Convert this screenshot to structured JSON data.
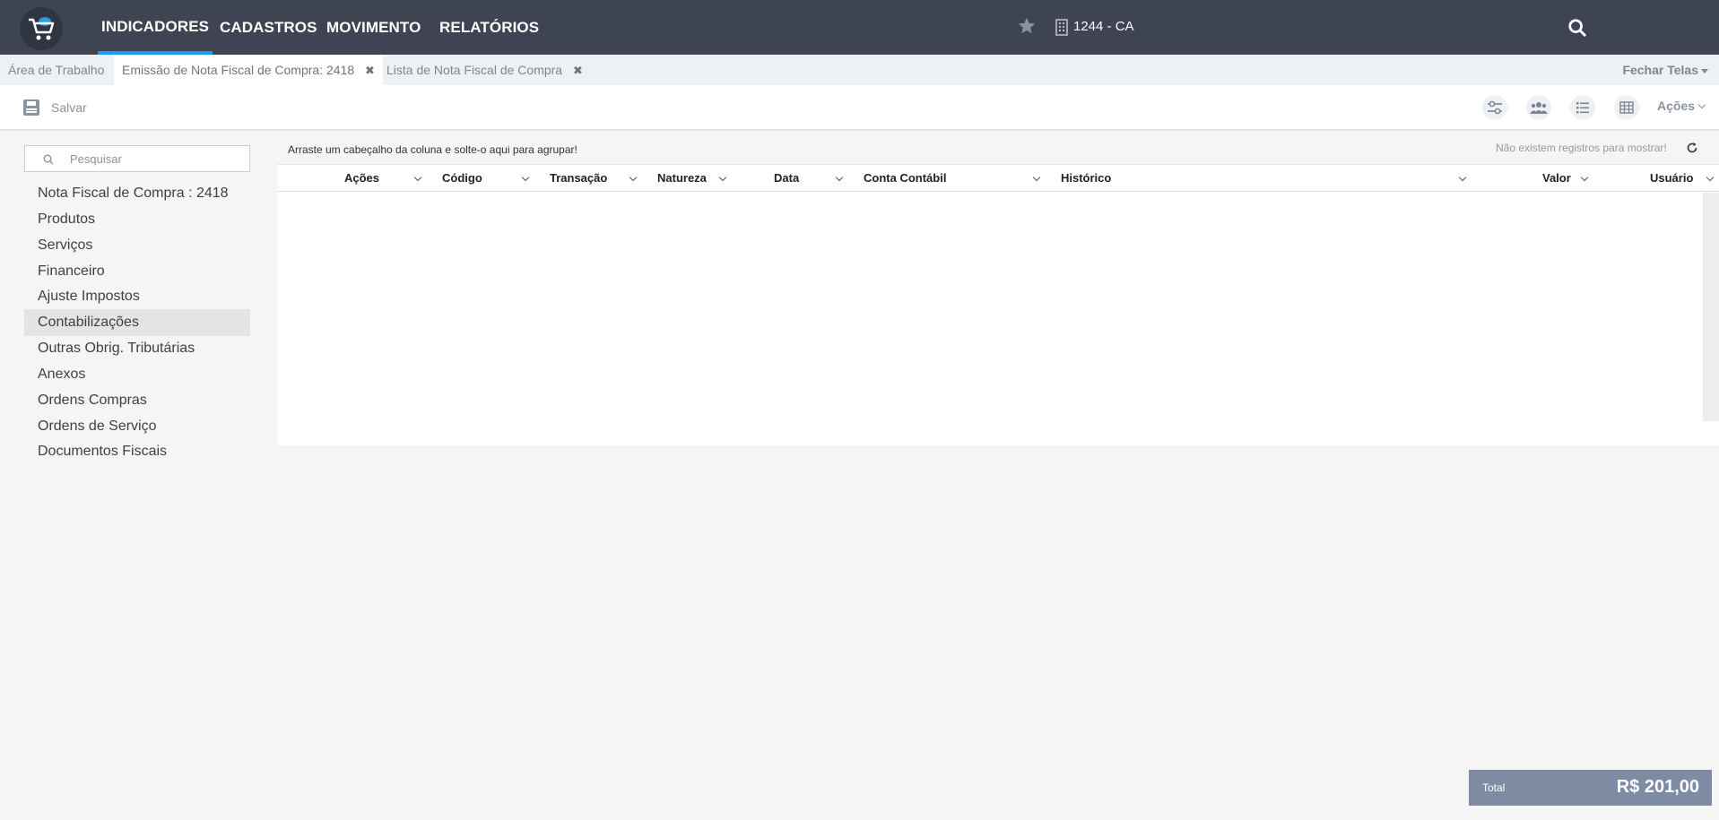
{
  "nav": {
    "items": [
      {
        "label": "INDICADORES",
        "active": true
      },
      {
        "label": "CADASTROS",
        "active": false
      },
      {
        "label": "MOVIMENTO",
        "active": false
      },
      {
        "label": "RELATÓRIOS",
        "active": false
      }
    ],
    "company": "1244 - CA",
    "icons": [
      "cart-logo-icon",
      "star-icon",
      "building-icon",
      "search-icon"
    ]
  },
  "tabs": {
    "items": [
      {
        "label": "Área de Trabalho",
        "closable": false,
        "active": false
      },
      {
        "label": "Emissão de Nota Fiscal de Compra: 2418",
        "closable": true,
        "active": true
      },
      {
        "label": "Lista de Nota Fiscal de Compra",
        "closable": true,
        "active": false
      }
    ],
    "close_all": "Fechar Telas"
  },
  "toolbar": {
    "save_label": "Salvar",
    "actions_label": "Ações",
    "icons": [
      "sliders-icon",
      "users-icon",
      "list-icon",
      "table-icon"
    ]
  },
  "sidebar": {
    "search_placeholder": "Pesquisar",
    "items": [
      {
        "label": "Nota Fiscal de Compra : 2418",
        "active": false
      },
      {
        "label": "Produtos",
        "active": false
      },
      {
        "label": "Serviços",
        "active": false
      },
      {
        "label": "Financeiro",
        "active": false
      },
      {
        "label": "Ajuste Impostos",
        "active": false
      },
      {
        "label": "Contabilizações",
        "active": true
      },
      {
        "label": "Outras Obrig. Tributárias",
        "active": false
      },
      {
        "label": "Anexos",
        "active": false
      },
      {
        "label": "Ordens Compras",
        "active": false
      },
      {
        "label": "Ordens de Serviço",
        "active": false
      },
      {
        "label": "Documentos Fiscais",
        "active": false
      }
    ]
  },
  "grid": {
    "group_hint": "Arraste um cabeçalho da coluna e solte-o aqui para agrupar!",
    "no_records": "Não existem registros para mostrar!",
    "columns": [
      "Ações",
      "Código",
      "Transação",
      "Natureza",
      "Data",
      "Conta Contábil",
      "Histórico",
      "Valor",
      "Usuário"
    ],
    "rows": []
  },
  "total": {
    "label": "Total",
    "value": "R$ 201,00"
  },
  "colors": {
    "navbar": "#3e4451",
    "nav_active_underline": "#1d9bf0",
    "total_bg": "#7f8aa3",
    "sidebar_active_bg": "#e4e4e4"
  }
}
